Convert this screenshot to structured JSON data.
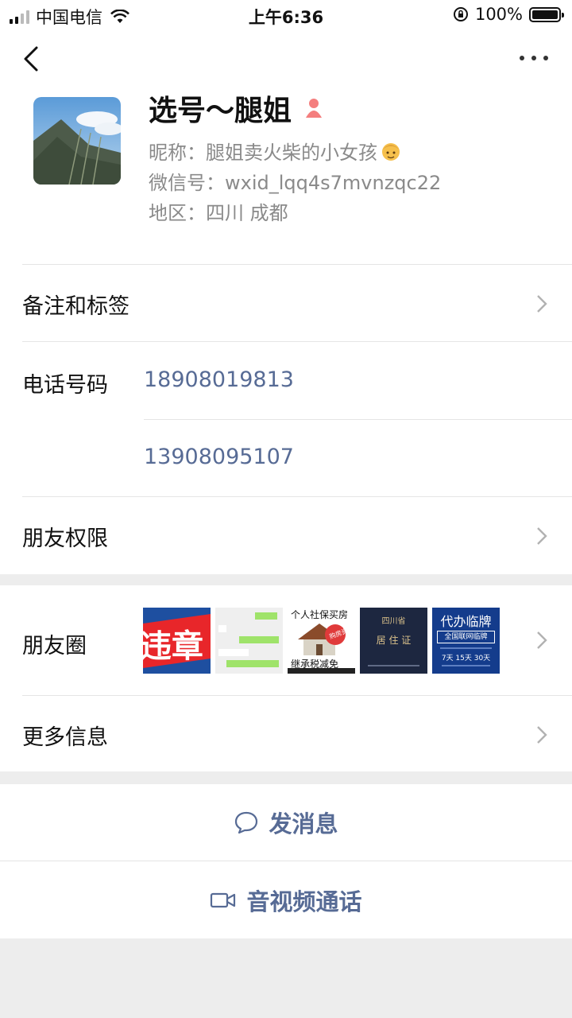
{
  "status_bar": {
    "carrier": "中国电信",
    "time": "上午6:36",
    "battery": "100%"
  },
  "profile": {
    "name": "选号～腿姐",
    "nickname_label": "昵称：",
    "nickname": "腿姐卖火柴的小女孩",
    "wechat_id_label": "微信号：",
    "wechat_id": "wxid_lqq4s7mvnzqc22",
    "region_label": "地区：",
    "region": "四川 成都"
  },
  "rows": {
    "remark_label": "备注和标签",
    "phone_label": "电话号码",
    "phones": [
      "18908019813",
      "13908095107"
    ],
    "permission_label": "朋友权限",
    "moments_label": "朋友圈",
    "more_label": "更多信息"
  },
  "moments_thumbs": {
    "t1": "违章",
    "t3_top": "个人社保买房",
    "t3_bottom": "继承税减免",
    "t3_badge": "购房资格",
    "t4_top": "四川省",
    "t4_main": "居 住 证",
    "t5_top": "代办临牌",
    "t5_sub": "全国联网临牌",
    "t5_days": "7天 15天 30天"
  },
  "actions": {
    "message": "发消息",
    "call": "音视频通话"
  }
}
